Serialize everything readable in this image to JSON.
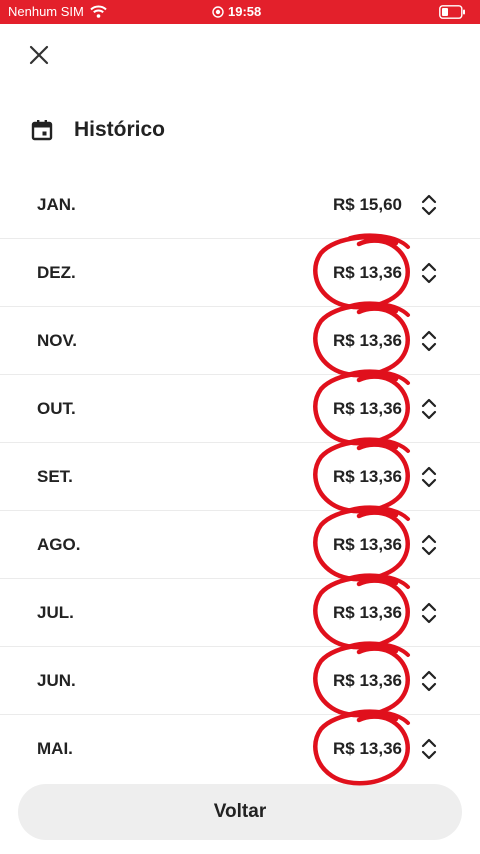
{
  "status_bar": {
    "carrier": "Nenhum SIM",
    "time": "19:58",
    "background_color": "#e3202b"
  },
  "header": {
    "close_icon": "close-icon",
    "calendar_icon": "calendar-icon",
    "title": "Histórico"
  },
  "history": [
    {
      "month": "JAN.",
      "amount": "R$ 15,60",
      "circled": false
    },
    {
      "month": "DEZ.",
      "amount": "R$ 13,36",
      "circled": true
    },
    {
      "month": "NOV.",
      "amount": "R$ 13,36",
      "circled": true
    },
    {
      "month": "OUT.",
      "amount": "R$ 13,36",
      "circled": true
    },
    {
      "month": "SET.",
      "amount": "R$ 13,36",
      "circled": true
    },
    {
      "month": "AGO.",
      "amount": "R$ 13,36",
      "circled": true
    },
    {
      "month": "JUL.",
      "amount": "R$ 13,36",
      "circled": true
    },
    {
      "month": "JUN.",
      "amount": "R$ 13,36",
      "circled": true
    },
    {
      "month": "MAI.",
      "amount": "R$ 13,36",
      "circled": true
    }
  ],
  "annotation_color": "#e0101c",
  "footer": {
    "back_label": "Voltar"
  }
}
